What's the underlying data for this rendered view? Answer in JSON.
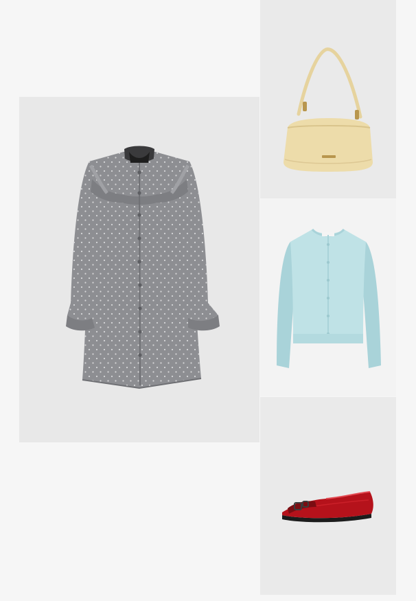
{
  "outfit": {
    "items": [
      {
        "id": "dress",
        "icon": "ruffle-dress-image",
        "color": "#8d8e92",
        "accent": "#1e1e1e",
        "dots": "#d6d6d8"
      },
      {
        "id": "bag",
        "icon": "shoulder-bag-image",
        "color": "#eddcaa",
        "strap": "#e6d39e",
        "hardware": "#b8964e"
      },
      {
        "id": "cardigan",
        "icon": "cardigan-image",
        "color": "#bfe2e6",
        "shade": "#a9d3d9"
      },
      {
        "id": "shoe",
        "icon": "ballet-flat-image",
        "color": "#b5121b",
        "sole": "#1c1c1c",
        "buckle": "#7a0d12"
      }
    ]
  }
}
